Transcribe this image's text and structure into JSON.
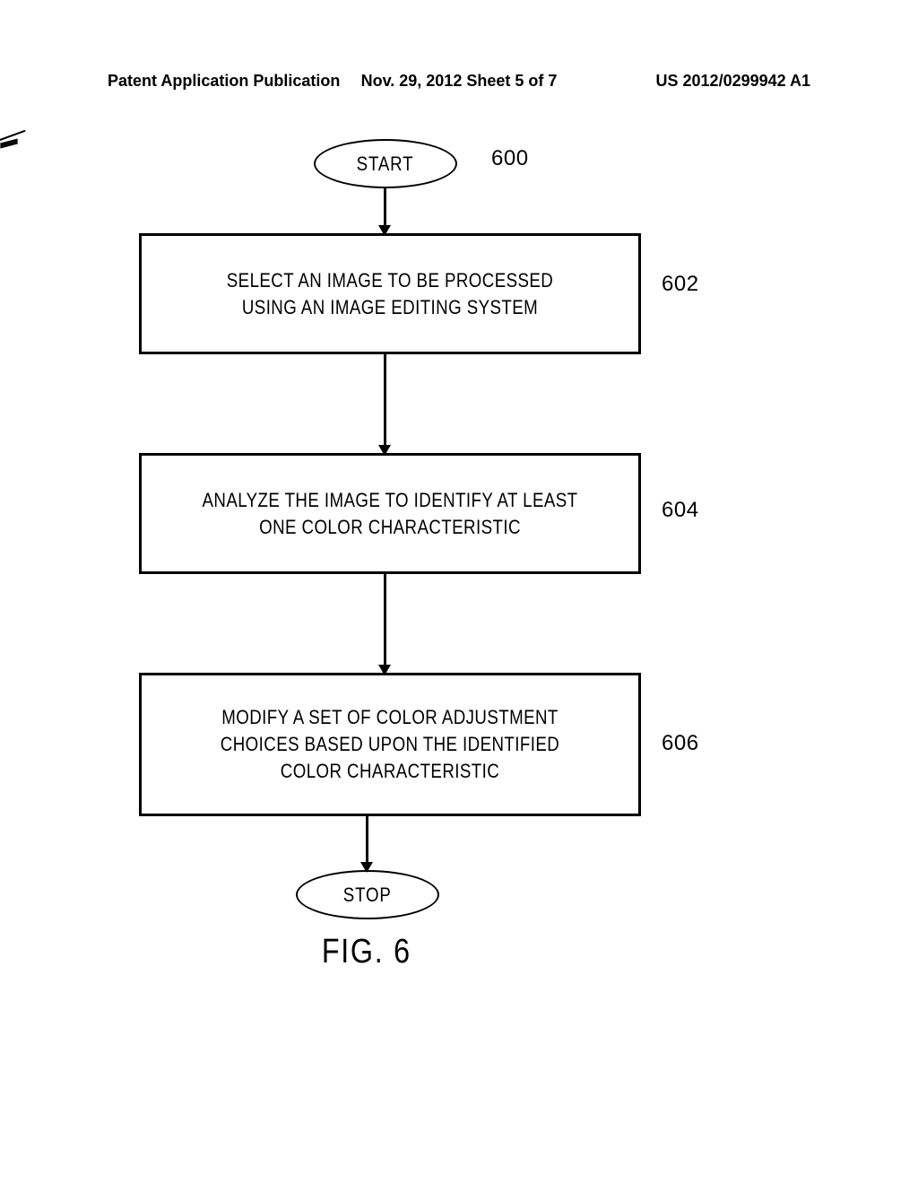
{
  "header": {
    "left": "Patent Application Publication",
    "center": "Nov. 29, 2012  Sheet 5 of 7",
    "right": "US 2012/0299942 A1"
  },
  "flowchart": {
    "start": "START",
    "step1": "SELECT AN IMAGE TO BE PROCESSED USING AN IMAGE EDITING SYSTEM",
    "step2": "ANALYZE THE IMAGE TO IDENTIFY AT LEAST ONE COLOR CHARACTERISTIC",
    "step3": "MODIFY A SET OF COLOR ADJUSTMENT CHOICES BASED UPON THE IDENTIFIED COLOR CHARACTERISTIC",
    "stop": "STOP"
  },
  "labels": {
    "l600": "600",
    "l602": "602",
    "l604": "604",
    "l606": "606"
  },
  "figure": "FIG. 6",
  "chart_data": {
    "type": "flowchart",
    "title": "FIG. 6",
    "nodes": [
      {
        "id": "600",
        "type": "terminal",
        "text": "START"
      },
      {
        "id": "602",
        "type": "process",
        "text": "SELECT AN IMAGE TO BE PROCESSED USING AN IMAGE EDITING SYSTEM"
      },
      {
        "id": "604",
        "type": "process",
        "text": "ANALYZE THE IMAGE TO IDENTIFY AT LEAST ONE COLOR CHARACTERISTIC"
      },
      {
        "id": "606",
        "type": "process",
        "text": "MODIFY A SET OF COLOR ADJUSTMENT CHOICES BASED UPON THE IDENTIFIED COLOR CHARACTERISTIC"
      },
      {
        "id": "stop",
        "type": "terminal",
        "text": "STOP"
      }
    ],
    "edges": [
      {
        "from": "600",
        "to": "602"
      },
      {
        "from": "602",
        "to": "604"
      },
      {
        "from": "604",
        "to": "606"
      },
      {
        "from": "606",
        "to": "stop"
      }
    ]
  }
}
